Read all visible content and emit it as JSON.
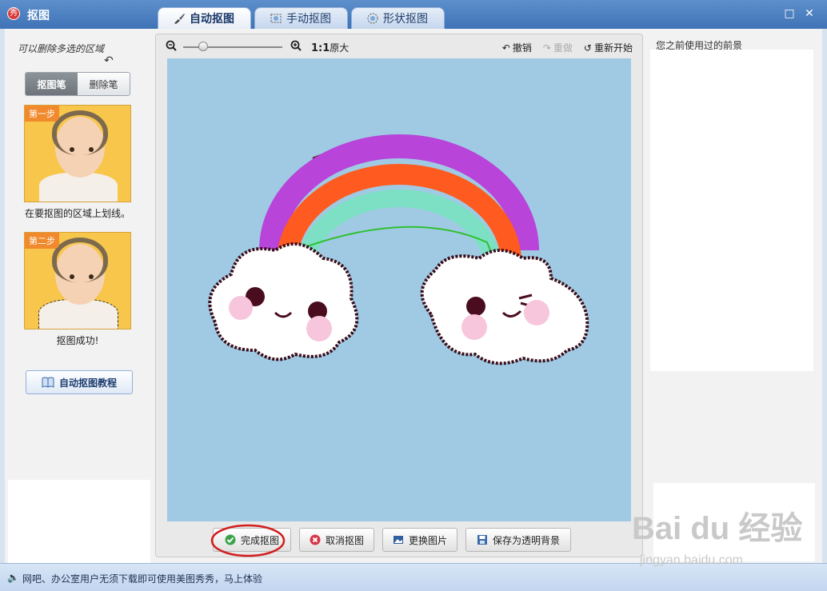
{
  "window": {
    "title": "抠图",
    "app_icon_text": "秀"
  },
  "tabs": [
    {
      "label": "自动抠图",
      "active": true
    },
    {
      "label": "手动抠图",
      "active": false
    },
    {
      "label": "形状抠图",
      "active": false
    }
  ],
  "left": {
    "hint": "可以删除多选的区域",
    "segments": {
      "pen": "抠图笔",
      "eraser": "删除笔"
    },
    "step1": {
      "badge": "第一步",
      "caption": "在要抠图的区域上划线。"
    },
    "step2": {
      "badge": "第二步",
      "caption": "抠图成功!"
    },
    "tutorial_label": "自动抠图教程"
  },
  "toolbar": {
    "ratio_bold": "1:1",
    "ratio_text": "原大",
    "undo": "撤销",
    "redo": "重做",
    "restart": "重新开始",
    "zoom_level": 0.2
  },
  "canvas": {
    "artwork_text": "Rainbow",
    "bg_color": "#a0cae3"
  },
  "buttons": {
    "finish": "完成抠图",
    "cancel": "取消抠图",
    "replace": "更换图片",
    "save": "保存为透明背景"
  },
  "right": {
    "title": "您之前使用过的前景"
  },
  "status": {
    "text": "网吧、办公室用户无须下载即可使用美图秀秀，马上体验"
  },
  "watermark": {
    "brand": "Bai du 经验",
    "url": "jingyan.baidu.com"
  }
}
